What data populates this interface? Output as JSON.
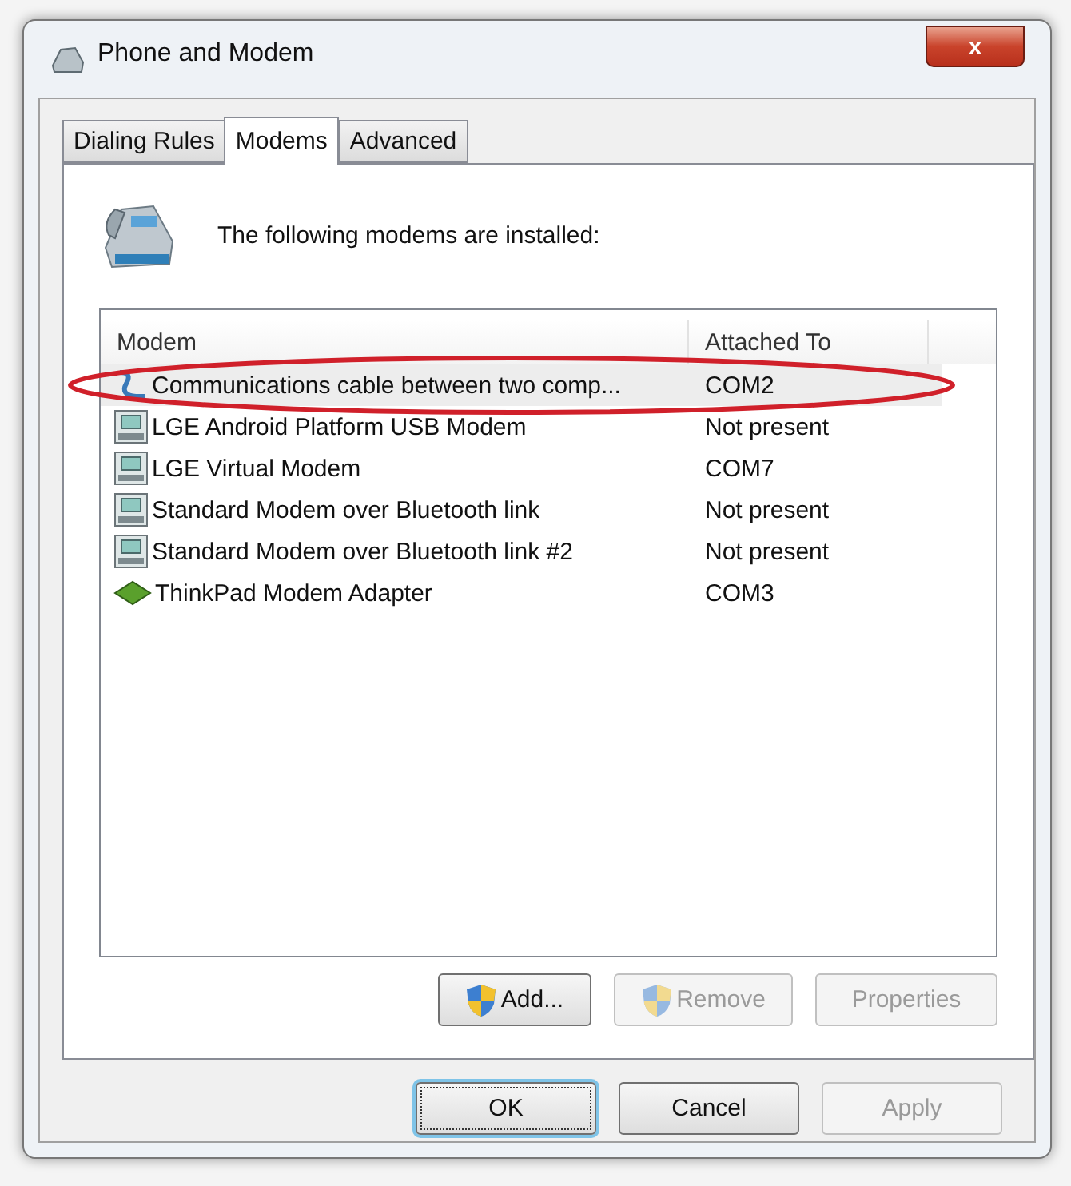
{
  "window": {
    "title": "Phone and Modem",
    "close_label": "x"
  },
  "tabs": [
    {
      "label": "Dialing Rules",
      "selected": false
    },
    {
      "label": "Modems",
      "selected": true
    },
    {
      "label": "Advanced",
      "selected": false
    }
  ],
  "intro": "The following modems are installed:",
  "table": {
    "columns": [
      "Modem",
      "Attached To"
    ],
    "rows": [
      {
        "kind": "cable",
        "name": "Communications cable between two comp...",
        "attached": "COM2",
        "selected": true
      },
      {
        "kind": "modem",
        "name": "LGE Android Platform USB Modem",
        "attached": "Not present",
        "selected": false
      },
      {
        "kind": "modem",
        "name": "LGE Virtual Modem",
        "attached": "COM7",
        "selected": false
      },
      {
        "kind": "modem",
        "name": "Standard Modem over Bluetooth link",
        "attached": "Not present",
        "selected": false
      },
      {
        "kind": "modem",
        "name": "Standard Modem over Bluetooth link #2",
        "attached": "Not present",
        "selected": false
      },
      {
        "kind": "card",
        "name": "ThinkPad Modem Adapter",
        "attached": "COM3",
        "selected": false
      }
    ]
  },
  "list_buttons": [
    {
      "label": "Add...",
      "shield": true,
      "disabled": false
    },
    {
      "label": "Remove",
      "shield": true,
      "disabled": true
    },
    {
      "label": "Properties",
      "shield": false,
      "disabled": true
    }
  ],
  "dialog_buttons": [
    {
      "label": "OK",
      "disabled": false,
      "focused": true
    },
    {
      "label": "Cancel",
      "disabled": false,
      "focused": false
    },
    {
      "label": "Apply",
      "disabled": true,
      "focused": false
    }
  ]
}
